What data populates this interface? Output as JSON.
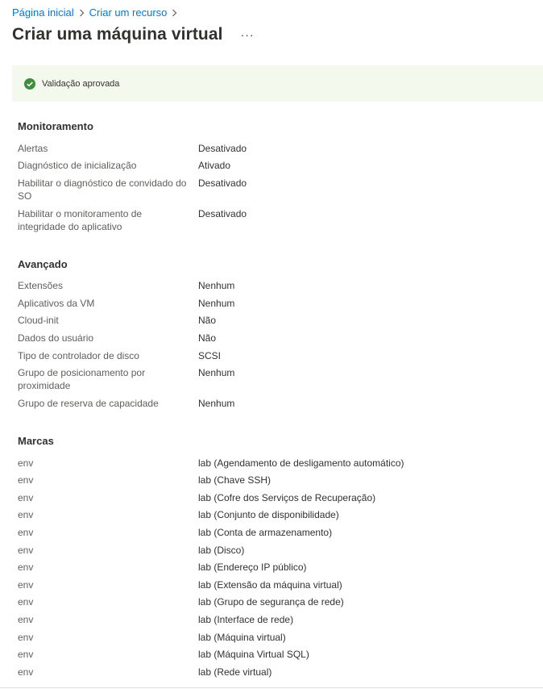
{
  "breadcrumb": [
    {
      "label": "Página inicial"
    },
    {
      "label": "Criar um recurso"
    }
  ],
  "page": {
    "title": "Criar uma máquina virtual",
    "more": "···"
  },
  "banner": {
    "text": "Validação aprovada",
    "color": "#3e8e3e"
  },
  "sections": {
    "monitoring": {
      "title": "Monitoramento",
      "rows": [
        {
          "key": "Alertas",
          "value": "Desativado"
        },
        {
          "key": "Diagnóstico de inicialização",
          "value": "Ativado"
        },
        {
          "key": "Habilitar o diagnóstico de convidado do SO",
          "value": "Desativado"
        },
        {
          "key": "Habilitar o monitoramento de integridade do aplicativo",
          "value": "Desativado"
        }
      ]
    },
    "advanced": {
      "title": "Avançado",
      "rows": [
        {
          "key": "Extensões",
          "value": "Nenhum"
        },
        {
          "key": "Aplicativos da VM",
          "value": "Nenhum"
        },
        {
          "key": "Cloud-init",
          "value": "Não"
        },
        {
          "key": "Dados do usuário",
          "value": "Não"
        },
        {
          "key": "Tipo de controlador de disco",
          "value": "SCSI"
        },
        {
          "key": "Grupo de posicionamento por proximidade",
          "value": "Nenhum"
        },
        {
          "key": "Grupo de reserva de capacidade",
          "value": "Nenhum"
        }
      ]
    },
    "tags": {
      "title": "Marcas",
      "rows": [
        {
          "key": "env",
          "value": "lab (Agendamento de desligamento automático)"
        },
        {
          "key": "env",
          "value": "lab (Chave SSH)"
        },
        {
          "key": "env",
          "value": "lab (Cofre dos Serviços de Recuperação)"
        },
        {
          "key": "env",
          "value": "lab (Conjunto de disponibilidade)"
        },
        {
          "key": "env",
          "value": "lab (Conta de armazenamento)"
        },
        {
          "key": "env",
          "value": "lab (Disco)"
        },
        {
          "key": "env",
          "value": "lab (Endereço IP público)"
        },
        {
          "key": "env",
          "value": "lab (Extensão da máquina virtual)"
        },
        {
          "key": "env",
          "value": "lab (Grupo de segurança de rede)"
        },
        {
          "key": "env",
          "value": "lab (Interface de rede)"
        },
        {
          "key": "env",
          "value": "lab (Máquina virtual)"
        },
        {
          "key": "env",
          "value": "lab (Máquina Virtual SQL)"
        },
        {
          "key": "env",
          "value": "lab (Rede virtual)"
        }
      ]
    }
  }
}
